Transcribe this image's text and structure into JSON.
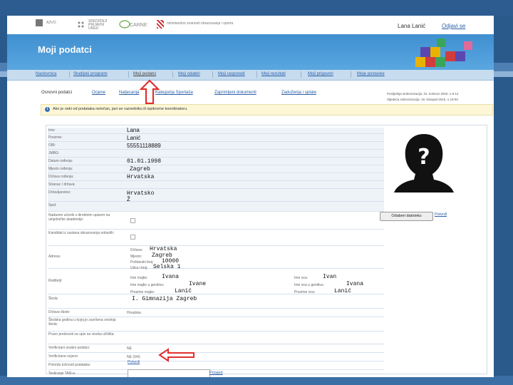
{
  "header": {
    "logos": [
      "AZVO",
      "SREDIŠNJI PRIJAVNI URED",
      "CARNET",
      "ministarstvo znanosti obrazovanja i sporta"
    ],
    "user_name": "Lana Lanić",
    "logout_label": "Odjavi se",
    "page_title": "Moji podatci"
  },
  "nav": {
    "items": [
      "Naslovnica",
      "Studijski programi",
      "Moji podatci",
      "Moji odabiri",
      "Moji rasporedi",
      "Moji rezultati",
      "Moji prigovori",
      "Moje postavke"
    ]
  },
  "subtabs": {
    "items": [
      "Osnovni podatci",
      "Ocjene",
      "Natjecanja",
      "Kategorija Sportaša",
      "Zaprimljeni dokumenti",
      "Zaduženja i uplate"
    ],
    "sync_last": "Posljednja sinkronizacija: 31. kolovoz 2015. u 6:12",
    "sync_next": "Sljedeća sinkronizacija: 19. listopad 2015. u 19:00"
  },
  "notice": {
    "icon": "info-icon",
    "text": "Ako je neki od podataka netočan, javi se razredniku ili ispitnome koordinatoru."
  },
  "form": {
    "labels": {
      "ime": "Ime:",
      "prezime": "Prezime:",
      "oib": "OIB:",
      "jmbg": "JMBG:",
      "datum": "Datum rođenja:",
      "mjesto": "Mjesto rođenja:",
      "drzava_rod": "Država rođenja:",
      "stranac": "Stranac / država:",
      "drzavljanstvo": "Državljanstvo:",
      "spol": "Spol:",
      "nadareni": "Nadareni učenik s direktnim upisom na umjetničke akademije:",
      "kandidat": "Kandidat iz sustava obrazovanja odraslih:",
      "adresa": "Adresa:",
      "roditelji": "Roditelji:",
      "skola": "Škola:",
      "drzava_skole": "Država škole:",
      "skolska_godina": "Školska godina u kojoj je završena srednja škola:",
      "pravo": "Pravo prednosti za upis na visoka učilišta:",
      "verif_osobni": "Verificirani osobni podatci:",
      "verif_ocjene": "Verificirane ocjene:",
      "potvrda": "Potvrda točnosti podataka:",
      "tan": "Testiranje TAN-a:"
    },
    "values": {
      "ime": "Lana",
      "prezime": "Lanić",
      "oib": "55551118889",
      "datum": "01.01.1998",
      "mjesto": "Zagreb",
      "drzava_rod": "Hrvatska",
      "drzavljanstvo": "Hrvatsko",
      "spol": "Ž",
      "skola": "I. Gimnazija Zagreb",
      "drzava_skole": "Hrvatska",
      "verif_osobni": "NE",
      "verif_ocjene": "NE (0/4)"
    },
    "address": {
      "drzava_label": "Država:",
      "drzava": "Hrvatska",
      "mjesto_label": "Mjesto:",
      "mjesto": "Zagreb",
      "postanski_label": "Poštanski broj:",
      "postanski": "10000",
      "ulica_label": "Ulica i broj:",
      "ulica": "Selska 1"
    },
    "parents": {
      "ime_majke_label": "Ime majke:",
      "ime_majke": "Ivana",
      "ime_majke_gen_label": "Ime majke u genitivu:",
      "ime_majke_gen": "Ivane",
      "prezime_majke_label": "Prezime majke:",
      "prezime_majke": "Lanić",
      "ime_oca_label": "Ime oca:",
      "ime_oca": "Ivan",
      "ime_oca_gen_label": "Ime oca u genitivu:",
      "ime_oca_gen": "Ivana",
      "prezime_oca_label": "Prezime oca:",
      "prezime_oca": "Lanić"
    },
    "photo": {
      "choose_label": "Odaberi datoteku",
      "confirm_label": "Potvrdi"
    },
    "confirm_link": "Potvrdi",
    "tan_check_link": "Provjeri"
  },
  "colors": {
    "banner": "#4a9ad8",
    "link": "#2a5fa8",
    "arrow": "#e03030"
  }
}
